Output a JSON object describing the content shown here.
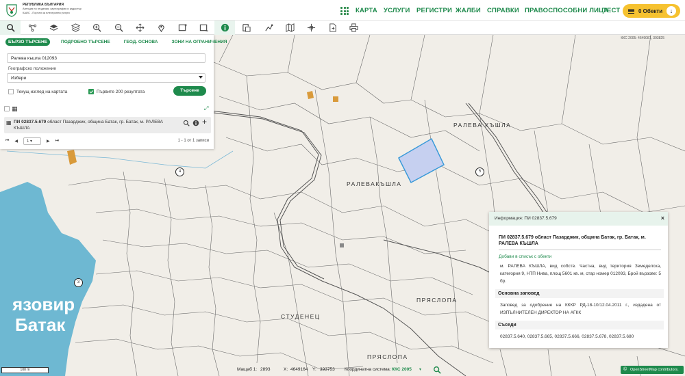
{
  "header": {
    "logo_line1": "РЕПУБЛИКА БЪЛГАРИЯ",
    "logo_line2": "Агенция по геодезия, картография и кадастър",
    "logo_line3": "КАИС - Портал за електронни услуги",
    "nav": [
      "КАРТА",
      "УСЛУГИ",
      "РЕГИСТРИ",
      "ЖАЛБИ",
      "СПРАВКИ",
      "ПРАВОСПОСОБНИ ЛИЦА",
      "ТЕСТ"
    ],
    "objects_button": "0 Обекти"
  },
  "toolbar": {
    "tools": [
      "search-icon",
      "measure-icon",
      "layers-icon",
      "layers-stack-icon",
      "zoom-in-icon",
      "zoom-out-icon",
      "pan-icon",
      "location-pin-icon",
      "select-rectangle-icon",
      "select-area-icon",
      "info-icon",
      "export-icon",
      "draw-icon",
      "map-icon",
      "crosshair-icon",
      "document-icon",
      "print-icon"
    ]
  },
  "search_panel": {
    "tabs": [
      "БЪРЗО ТЪРСЕНЕ",
      "ПОДРОБНО ТЪРСЕНЕ",
      "ГЕОД. ОСНОВА",
      "ЗОНИ НА ОГРАНИЧЕНИЯ"
    ],
    "query_value": "Ралева къшла 012093",
    "geo_label": "Географско положение",
    "geo_select_value": "Избери",
    "checkbox_current_view": "Текущ изглед на картата",
    "checkbox_first_200": "Първите 200 резултата",
    "search_button": "Търсене",
    "result_text": "ПИ 02837.5.679 област Пазарджик, община Батак, гр. Батак, м. РАЛЕВА КЪШЛА",
    "result_id": "ПИ 02837.5.679",
    "result_rest": " област Пазарджик, община Батак, гр. Батак, м. РАЛЕВА КЪШЛА",
    "page_value": "1",
    "records": "1 - 1 от 1 записи"
  },
  "map": {
    "lake_label_1": "язовир",
    "lake_label_2": "Батак",
    "labels": [
      "РАЛЕВА КЪШЛА",
      "РАЛЕВАКЪШЛА",
      "ПРЯСЛОПА",
      "СТУДЕНЕЦ",
      "ПРЯСЛОПА"
    ],
    "circle_numbers": [
      "4",
      "5",
      "3"
    ],
    "top_coord": "ККС 2005: 4649081, 393825"
  },
  "info_popup": {
    "header": "Информация: ПИ 02837.5.679",
    "title": "ПИ 02837.5.679 област Пазарджик, община Батак, гр. Батак, м. РАЛЕВА КЪШЛА",
    "add_link": "Добави в списък с обекти",
    "description": "м. РАЛЕВА КЪШЛА, вид собств. Частна, вид територия Земеделска, категория 9, НТП Нива, площ 5601 кв. м, стар номер 012093, Брой вързове: 5 бр.",
    "section_order": "Основна заповед",
    "order_text": "Заповед за одобрение на КККР РД-18-10/12.04.2011 г., издадена от ИЗПЪЛНИТЕЛЕН ДИРЕКТОР НА АГКК",
    "section_neighbours": "Съседи",
    "neighbours": "02837.5.640, 02837.5.665, 02837.5.666, 02837.5.678, 02837.5.680"
  },
  "status": {
    "scale_bar": "100 m",
    "scale_label": "Мащаб 1:",
    "scale_value": "2893",
    "x_label": "X:",
    "x_value": "4649164",
    "y_label": "Y:",
    "y_value": "393753",
    "crs_label": "Координатна система:",
    "crs_value": "ККС 2005",
    "osm": "OpenStreetMap contributors."
  },
  "colors": {
    "brand_green": "#1e8a4c",
    "accent_yellow": "#f6c230",
    "lake_blue": "#6eb8d2",
    "highlight_parcel": "#c6d0f0"
  }
}
